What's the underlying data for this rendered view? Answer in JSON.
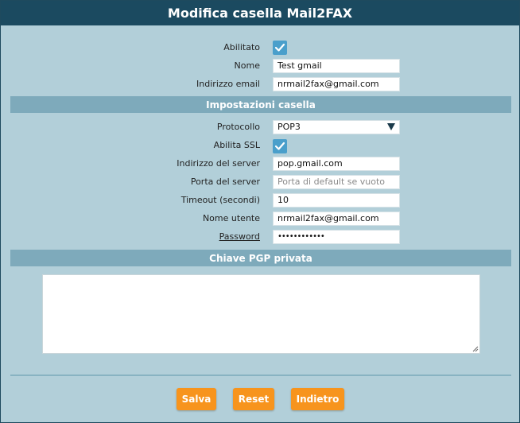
{
  "window": {
    "title": "Modifica casella Mail2FAX"
  },
  "general": {
    "enabled_label": "Abilitato",
    "enabled_checked": true,
    "name_label": "Nome",
    "name_value": "Test gmail",
    "email_label": "Indirizzo email",
    "email_value": "nrmail2fax@gmail.com"
  },
  "mailbox_settings": {
    "header": "Impostazioni casella",
    "protocol_label": "Protocollo",
    "protocol_value": "POP3",
    "ssl_label": "Abilita SSL",
    "ssl_checked": true,
    "server_label": "Indirizzo del server",
    "server_value": "pop.gmail.com",
    "port_label": "Porta del server",
    "port_placeholder": "Porta di default se vuoto",
    "port_value": "",
    "timeout_label": "Timeout (secondi)",
    "timeout_value": "10",
    "username_label": "Nome utente",
    "username_value": "nrmail2fax@gmail.com",
    "password_label": "Password",
    "password_value": "••••••••••••"
  },
  "pgp": {
    "header": "Chiave PGP privata",
    "value": ""
  },
  "actions": {
    "save_label": "Salva",
    "reset_label": "Reset",
    "back_label": "Indietro"
  },
  "colors": {
    "title_bar": "#1b4a60",
    "background": "#b2cfd9",
    "section_header": "#7eaabb",
    "button": "#f7941d",
    "checkbox": "#4a9fcb"
  },
  "icons": {
    "checkbox_check": "check-icon",
    "select_arrow": "chevron-down-icon"
  }
}
